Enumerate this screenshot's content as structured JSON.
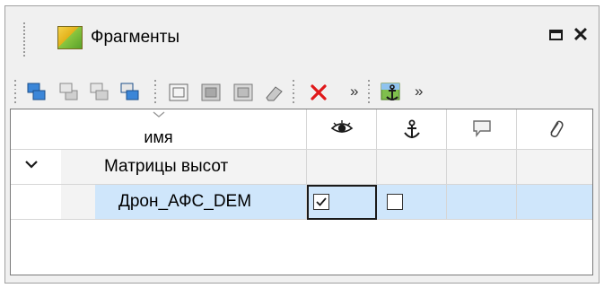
{
  "window": {
    "title": "Фрагменты"
  },
  "toolbar": {
    "overflow_left": "»",
    "overflow_right": "»"
  },
  "grid": {
    "columns": {
      "name": "имя",
      "visible": "eye-icon",
      "anchor": "anchor-icon",
      "comment": "speech-bubble-icon",
      "attachment": "paperclip-icon"
    },
    "rows": [
      {
        "name": "Матрицы высот",
        "expanded": true
      },
      {
        "name": "Дрон_АФС_DEM",
        "visible": true,
        "anchored": false
      }
    ]
  },
  "colors": {
    "selection": "#cfe6fb",
    "delete_red": "#e0181a"
  }
}
